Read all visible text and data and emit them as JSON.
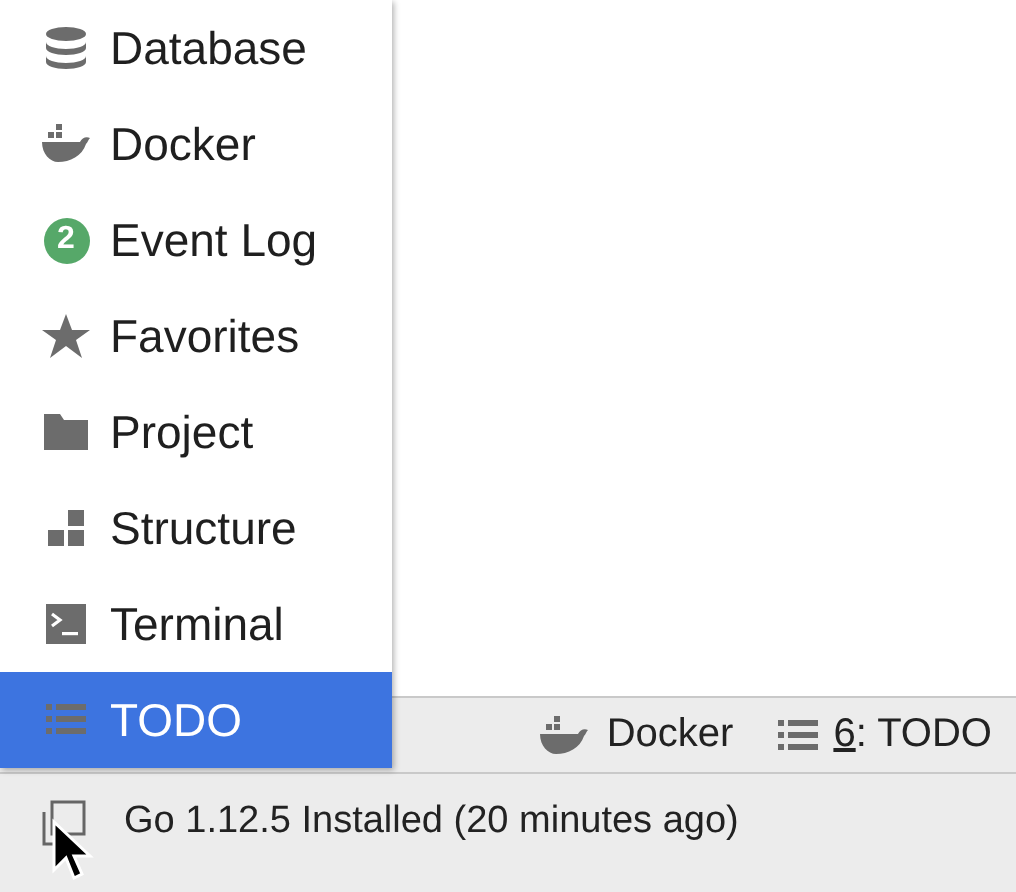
{
  "menu": {
    "items": [
      {
        "kind": "database",
        "label": "Database",
        "selected": false
      },
      {
        "kind": "docker",
        "label": "Docker",
        "selected": false
      },
      {
        "kind": "badge",
        "badge": "2",
        "label": "Event Log",
        "selected": false
      },
      {
        "kind": "star",
        "label": "Favorites",
        "selected": false
      },
      {
        "kind": "folder",
        "label": "Project",
        "selected": false
      },
      {
        "kind": "structure",
        "label": "Structure",
        "selected": false
      },
      {
        "kind": "terminal",
        "label": "Terminal",
        "selected": false
      },
      {
        "kind": "list",
        "label": "TODO",
        "selected": true
      }
    ]
  },
  "tool_window_bar": {
    "buttons": [
      {
        "kind": "docker",
        "label": "Docker"
      },
      {
        "kind": "list",
        "mnemonic": "6",
        "label": ": TODO"
      }
    ]
  },
  "status_bar": {
    "message": "Go 1.12.5 Installed (20 minutes ago)"
  }
}
